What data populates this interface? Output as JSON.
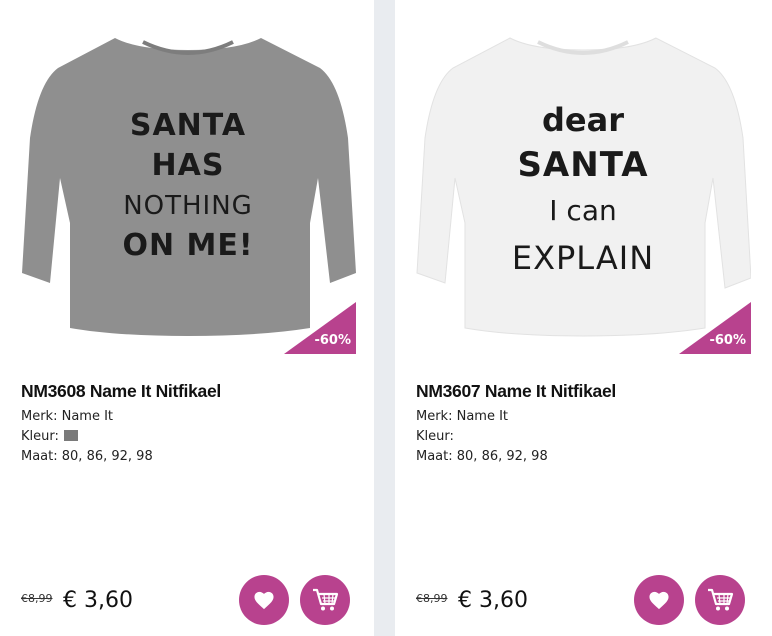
{
  "products": [
    {
      "title": "NM3608 Name It Nitfikael",
      "brand": "Merk: Name It",
      "color_label": "Kleur:",
      "sizes": "Maat: 80, 86, 92, 98",
      "old_price": "€8,99",
      "price": "€ 3,60",
      "discount": "-60%",
      "shirt_text": [
        "SANTA",
        "HAS",
        "NOTHING",
        "ON ME!"
      ],
      "shirt_color": "#8f8f8f"
    },
    {
      "title": "NM3607 Name It Nitfikael",
      "brand": "Merk: Name It",
      "color_label": "Kleur:",
      "sizes": "Maat: 80, 86, 92, 98",
      "old_price": "€8,99",
      "price": "€ 3,60",
      "discount": "-60%",
      "shirt_text": [
        "dear",
        "SANTA",
        "I can",
        "EXPLAIN"
      ],
      "shirt_color": "#f2f2f2"
    }
  ],
  "colors": {
    "accent": "#b8428e",
    "background": "#e9ecf0"
  }
}
